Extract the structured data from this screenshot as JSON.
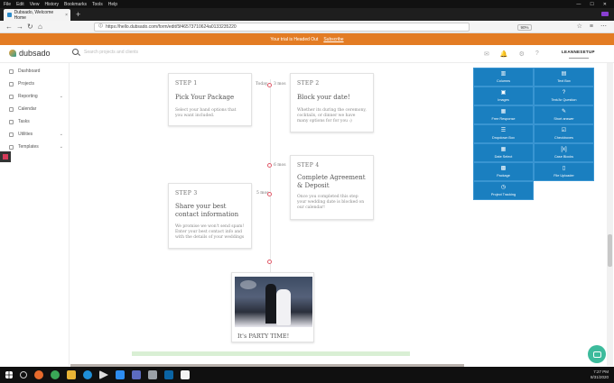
{
  "browser": {
    "menu": [
      "File",
      "Edit",
      "View",
      "History",
      "Bookmarks",
      "Tools",
      "Help"
    ],
    "tab_title": "Dubsado, Welcome Home",
    "tab_close": "×",
    "new_tab": "+",
    "url": "https://hello.dubsado.com/form/edit/5f46573710624a0133235220",
    "zoom": "90%",
    "back": "←",
    "forward": "→",
    "reload": "↻",
    "home": "⌂",
    "shield": "🛈",
    "nav_icons": [
      "☆",
      "≡",
      "⋯"
    ],
    "win_min": "—",
    "win_max": "☐",
    "win_close": "✕"
  },
  "banner": {
    "text": "Your trial is Headed Out",
    "link": "Subscribe"
  },
  "app": {
    "logo_text": "dubsado",
    "search_placeholder": "Search projects and clients",
    "header_icons": [
      "✉",
      "🔔",
      "⚙",
      "?"
    ],
    "brand": "LEANNESETUP"
  },
  "sidebar": {
    "items": [
      {
        "label": "Dashboard",
        "chevron": ""
      },
      {
        "label": "Projects",
        "chevron": ""
      },
      {
        "label": "Reporting",
        "chevron": "⌄"
      },
      {
        "label": "Calendar",
        "chevron": ""
      },
      {
        "label": "Tasks",
        "chevron": ""
      },
      {
        "label": "Utilities",
        "chevron": "⌄"
      },
      {
        "label": "Templates",
        "chevron": "⌄"
      }
    ]
  },
  "timeline": {
    "labels": [
      "Today",
      "3 mos",
      "6 mos",
      "5 mos"
    ],
    "steps": [
      {
        "num": "STEP 1",
        "title": "Pick Your Package",
        "desc": "Select your band options that you want included."
      },
      {
        "num": "STEP 2",
        "title": "Block your date!",
        "desc": "Whether its during the ceremony, cocktails, or dinner we have many options for for you :)"
      },
      {
        "num": "STEP 3",
        "title": "Share your best contact information",
        "desc": "We promise we won't send spam! Enter your best contact info and with the details of your weddings"
      },
      {
        "num": "STEP 4",
        "title": "Complete Agreement & Deposit",
        "desc": "Once you completed this step your wedding date is blocked on our calendar!"
      }
    ],
    "party_caption": "It's PARTY TIME!"
  },
  "blocks": [
    {
      "label": "Columns",
      "icon": "▥"
    },
    {
      "label": "Text Box",
      "icon": "▤"
    },
    {
      "label": "Images",
      "icon": "▣"
    },
    {
      "label": "Text/Ar Question",
      "icon": "?"
    },
    {
      "label": "Free Response",
      "icon": "▦"
    },
    {
      "label": "Short answer",
      "icon": "✎"
    },
    {
      "label": "Dropdown Box",
      "icon": "☰"
    },
    {
      "label": "Checkboxes",
      "icon": "☑"
    },
    {
      "label": "Date Select",
      "icon": "▦"
    },
    {
      "label": "Case Blocks",
      "icon": "[x]"
    },
    {
      "label": "Package",
      "icon": "▩"
    },
    {
      "label": "File Uploader",
      "icon": "▯"
    },
    {
      "label": "Project Tracking",
      "icon": "◷"
    }
  ],
  "taskbar": {
    "time": "7:27 PM",
    "date": "8/31/2020"
  },
  "colors": {
    "banner": "#e37c24",
    "block": "#1a7fc0",
    "timeline_dot": "#e05a6a",
    "chat": "#3dbb9c"
  }
}
